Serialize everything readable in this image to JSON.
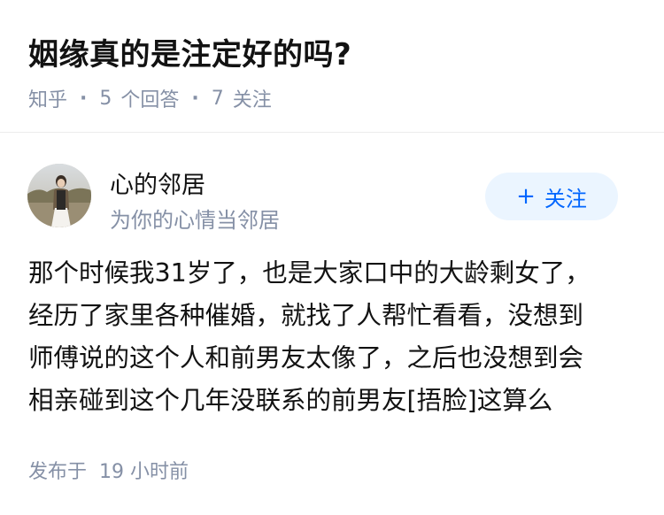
{
  "question": {
    "title": "姻缘真的是注定好的吗?",
    "source": "知乎",
    "answer_count": "5",
    "answer_label": "个回答",
    "follower_count": "7",
    "follower_label": "关注",
    "separator": "·"
  },
  "answer": {
    "author": {
      "name": "心的邻居",
      "bio": "为你的心情当邻居",
      "avatar_icon": "avatar-photo"
    },
    "follow_button": {
      "icon": "plus-icon",
      "plus_glyph": "+",
      "label": "关注"
    },
    "content_lines": [
      "那个时候我31岁了，也是大家口中的大龄剩女了，",
      "经历了家里各种催婚，就找了人帮忙看看，没想到",
      "师傅说的这个人和前男友太像了，之后也没想到会",
      "相亲碰到这个几年没联系的前男友[捂脸]这算么"
    ],
    "time_label": "发布于",
    "time_value": "19 小时前"
  },
  "colors": {
    "title": "#121212",
    "meta": "#8590a6",
    "accent": "#0066ff",
    "follow_bg": "#ebf5ff",
    "divider": "#ececec"
  }
}
